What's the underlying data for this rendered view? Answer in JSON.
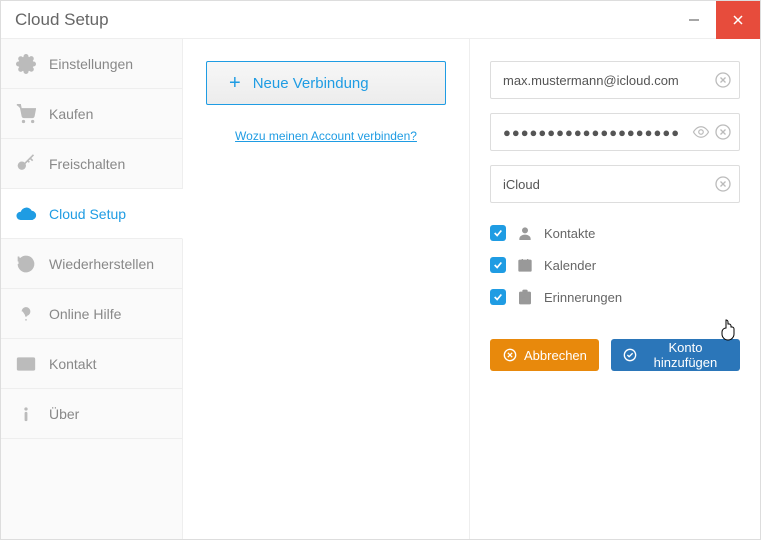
{
  "window": {
    "title": "Cloud Setup"
  },
  "sidebar": {
    "items": [
      {
        "label": "Einstellungen"
      },
      {
        "label": "Kaufen"
      },
      {
        "label": "Freischalten"
      },
      {
        "label": "Cloud Setup"
      },
      {
        "label": "Wiederherstellen"
      },
      {
        "label": "Online Hilfe"
      },
      {
        "label": "Kontakt"
      },
      {
        "label": "Über"
      }
    ],
    "active_index": 3
  },
  "mid": {
    "new_connection_label": "Neue Verbindung",
    "why_link": "Wozu meinen Account verbinden?"
  },
  "form": {
    "email": "max.mustermann@icloud.com",
    "password_mask": "●●●●●●●●●●●●●●●●●●●●",
    "service": "iCloud",
    "options": [
      {
        "label": "Kontakte",
        "checked": true
      },
      {
        "label": "Kalender",
        "checked": true
      },
      {
        "label": "Erinnerungen",
        "checked": true
      }
    ],
    "cancel_label": "Abbrechen",
    "confirm_label": "Konto hinzufügen"
  }
}
